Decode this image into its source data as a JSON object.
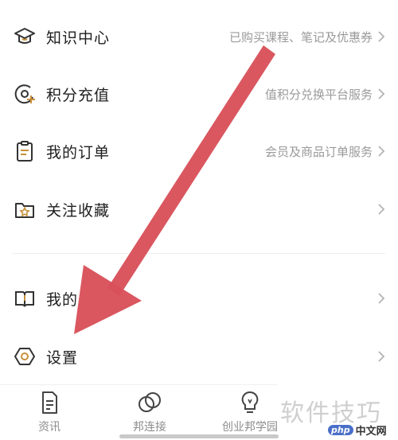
{
  "menu": {
    "items": [
      {
        "label": "知识中心",
        "sub": "已购买课程、笔记及优惠券"
      },
      {
        "label": "积分充值",
        "sub": "值积分兑换平台服务"
      },
      {
        "label": "我的订单",
        "sub": "会员及商品订单服务"
      },
      {
        "label": "关注收藏",
        "sub": ""
      },
      {
        "label": "我的",
        "sub": ""
      },
      {
        "label": "设置",
        "sub": ""
      }
    ]
  },
  "tabbar": {
    "tabs": [
      {
        "label": "资讯",
        "icon": "document-icon"
      },
      {
        "label": "邦连接",
        "icon": "linked-circles-icon"
      },
      {
        "label": "创业邦学园",
        "icon": "lightbulb-icon"
      }
    ]
  },
  "watermark": {
    "text": "软件技巧",
    "badge": "php",
    "site": "中文网"
  },
  "colors": {
    "accent": "#c8903a",
    "arrow": "#d9505a"
  }
}
